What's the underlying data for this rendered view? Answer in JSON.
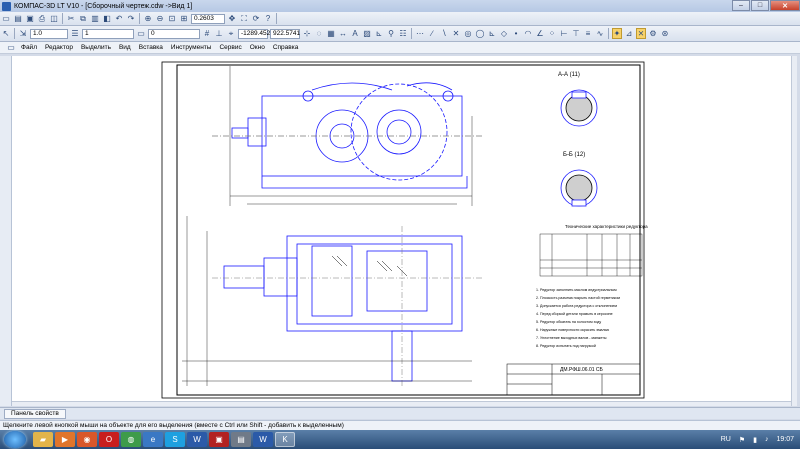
{
  "window": {
    "title": "КОМПАС-3D LT V10 - [Сборочный чертеж.cdw ->Вид 1]"
  },
  "toolbar1": {
    "zoom_value": "0.2603"
  },
  "toolbar2": {
    "scale_value": "1.0",
    "layer_value": "1",
    "style_value": "0",
    "coord_x": "-1289.452",
    "coord_y": "922.5741"
  },
  "menu": [
    "Файл",
    "Редактор",
    "Выделить",
    "Вид",
    "Вставка",
    "Инструменты",
    "Сервис",
    "Окно",
    "Справка"
  ],
  "panel": {
    "tab_label": "Панель свойств"
  },
  "status": {
    "hint": "Щелкните левой кнопкой мыши на объекте для его выделения (вместе с Ctrl или Shift - добавить к выделенным)"
  },
  "drawing": {
    "section_a": "А-А (11)",
    "section_b": "Б-Б (12)",
    "stamp": "ДМ.РФШ.06.01 СБ",
    "notes_title": "Технические характеристики редуктора",
    "notes": [
      "1. Редуктор заполнить маслом индустриальным",
      "2. Плоскость разъема покрыть пастой герметиком",
      "3. Допускается работа редуктора с отклонением",
      "4. Перед сборкой детали промыть в керосине",
      "5. Редуктор обкатать на холостом ходу",
      "6. Наружные поверхности окрасить эмалью",
      "7. Уплотнение выходных валов - манжеты",
      "8. Редуктор испытать под нагрузкой"
    ]
  },
  "taskbar": {
    "lang": "RU",
    "clock": "19:07"
  },
  "colors": {
    "drawing_blue": "#1a1aff",
    "drawing_black": "#000000",
    "titlebar": "#b6c8e4",
    "taskbar": "#2a4d77"
  }
}
